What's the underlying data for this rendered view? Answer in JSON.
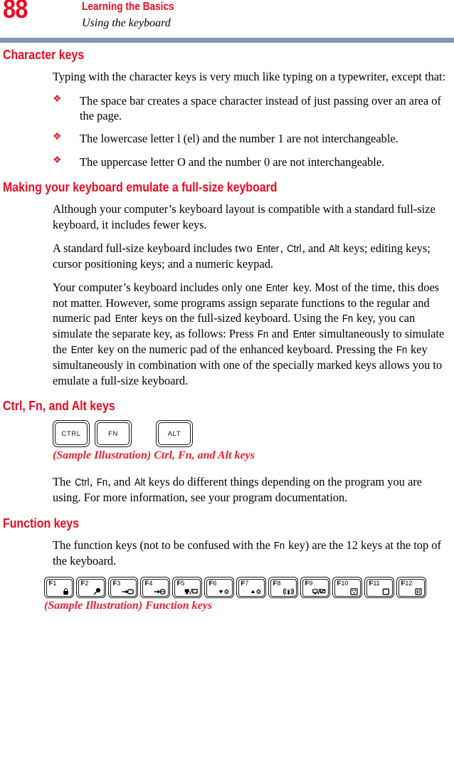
{
  "header": {
    "page_number": "88",
    "book_title": "Learning the Basics",
    "section_title": "Using the keyboard",
    "rule_color": "#8096ae",
    "accent_color": "#ed0a21"
  },
  "sections": [
    {
      "heading": "Character keys",
      "intro": "Typing with the character keys is very much like typing on a typewriter, except that:",
      "bullets": [
        "The space bar creates a space character instead of just passing over an area of the page.",
        "The lowercase letter l (el) and the number 1 are not interchangeable.",
        "The uppercase letter O and the number 0 are not interchangeable."
      ]
    },
    {
      "heading": "Making your keyboard emulate a full-size keyboard",
      "paragraphs": [
        "Although your computer’s keyboard layout is compatible with a standard full-size keyboard, it includes fewer keys.",
        "A standard full-size keyboard includes two Enter, Ctrl, and Alt keys; editing keys; cursor positioning keys; and a numeric keypad.",
        "Your computer’s keyboard includes only one Enter key. Most of the time, this does not matter. However, some programs assign separate functions to the regular and numeric pad Enter keys on the full-sized keyboard. Using the Fn key, you can simulate the separate key, as follows: Press Fn and Enter simultaneously to simulate the Enter key on the numeric pad of the enhanced keyboard. Pressing the Fn key simultaneously in combination with one of the specially marked keys allows you to emulate a full-size keyboard."
      ]
    },
    {
      "heading": "Ctrl, Fn, and Alt keys",
      "caption": "(Sample Illustration) Ctrl, Fn, and Alt keys",
      "after_text": "The Ctrl, Fn, and Alt keys do different things depending on the program you are using. For more information, see your program documentation."
    },
    {
      "heading": "Function keys",
      "intro": "The function keys (not to be confused with the Fn key) are the 12 keys at the top of the keyboard.",
      "caption": "(Sample Illustration) Function keys"
    }
  ],
  "modifier_keys": [
    {
      "label": "CTRL"
    },
    {
      "label": "FN"
    },
    {
      "label": "ALT"
    }
  ],
  "function_keys": [
    {
      "label": "F",
      "num": "1",
      "icon": "padlock-icon"
    },
    {
      "label": "F",
      "num": "2",
      "icon": "magnifier-icon"
    },
    {
      "label": "F",
      "num": "3",
      "icon": "standby-icon"
    },
    {
      "label": "F",
      "num": "4",
      "icon": "hibernate-icon"
    },
    {
      "label": "F",
      "num": "5",
      "icon": "display-switch-icon"
    },
    {
      "label": "F",
      "num": "6",
      "icon": "brightness-down-icon"
    },
    {
      "label": "F",
      "num": "7",
      "icon": "brightness-up-icon"
    },
    {
      "label": "F",
      "num": "8",
      "icon": "wireless-icon"
    },
    {
      "label": "F",
      "num": "9",
      "icon": "touchpad-toggle-icon"
    },
    {
      "label": "F",
      "num": "10",
      "icon": "cursor-overlay-icon"
    },
    {
      "label": "F",
      "num": "11",
      "icon": "numeric-overlay-icon"
    },
    {
      "label": "F",
      "num": "12",
      "icon": "scroll-lock-icon"
    }
  ],
  "bullet_symbol": "❖",
  "inline_key_terms": [
    "Enter",
    "Ctrl",
    "Alt",
    "Fn"
  ]
}
